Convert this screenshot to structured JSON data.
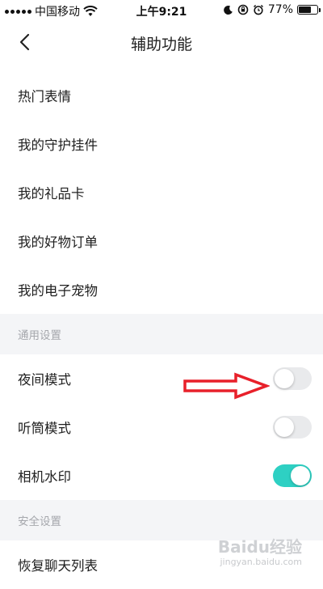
{
  "status_bar": {
    "carrier": "中国移动",
    "time": "上午9:21",
    "battery_text": "77%",
    "battery_level": 0.77
  },
  "nav": {
    "title": "辅助功能",
    "back_icon": "chevron-left-icon"
  },
  "menu_items": [
    "热门表情",
    "我的守护挂件",
    "我的礼品卡",
    "我的好物订单",
    "我的电子宠物"
  ],
  "general_settings": {
    "header": "通用设置",
    "items": [
      {
        "label": "夜间模式",
        "on": false
      },
      {
        "label": "听筒模式",
        "on": false
      },
      {
        "label": "相机水印",
        "on": true
      }
    ]
  },
  "security_settings": {
    "header": "安全设置",
    "partial_item": "恢复聊天列表"
  },
  "colors": {
    "toggle_on": "#2ed0c3",
    "toggle_off": "#e9eaec",
    "section_bg": "#f4f5f7",
    "annotation_arrow": "#e8202a"
  },
  "watermark": {
    "brand": "Baidu经验",
    "url": "jingyan.baidu.com"
  }
}
